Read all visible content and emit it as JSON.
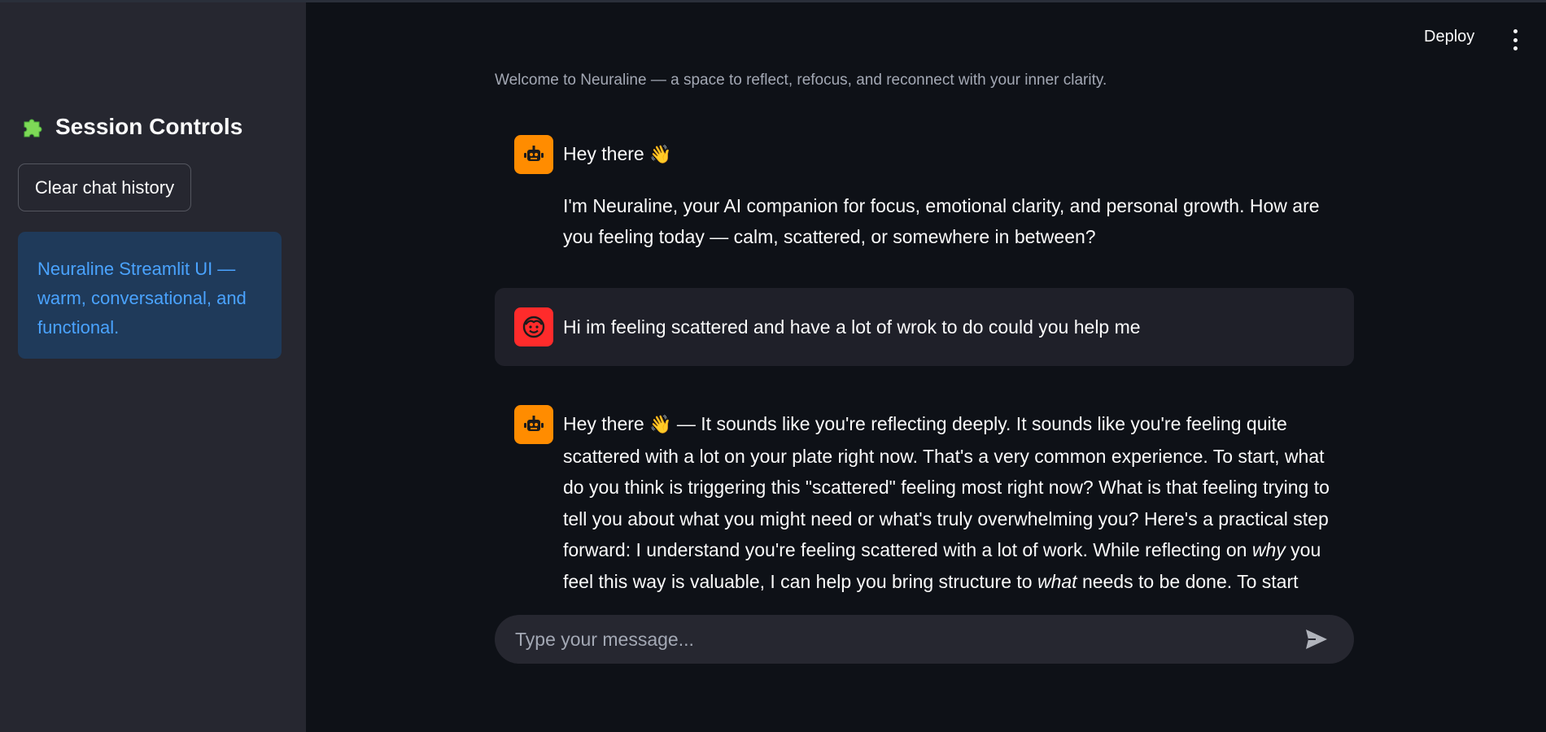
{
  "sidebar": {
    "title_icon": "puzzle-icon",
    "title": "Session Controls",
    "clear_button_label": "Clear chat history",
    "info_text": "Neuraline Streamlit UI — warm, conversational, and functional."
  },
  "header": {
    "deploy_label": "Deploy",
    "menu_icon": "vertical-dots-icon"
  },
  "main": {
    "caption": "Welcome to Neuraline — a space to reflect, refocus, and reconnect with your inner clarity.",
    "messages": [
      {
        "role": "assistant",
        "avatar_icon": "robot-icon",
        "greeting": "Hey there",
        "wave": "👋",
        "body": "I'm Neuraline, your AI companion for focus, emotional clarity, and personal growth. How are you feeling today — calm, scattered, or somewhere in between?"
      },
      {
        "role": "user",
        "avatar_icon": "smiley-face-icon",
        "text": "Hi im feeling scattered and have a lot of wrok to do could you help me"
      },
      {
        "role": "assistant",
        "avatar_icon": "robot-icon",
        "greeting": "Hey there",
        "wave": "👋",
        "text_part1": " — It sounds like you're reflecting deeply. It sounds like you're feeling quite scattered with a lot on your plate right now. That's a very common experience. To start, what do you think is triggering this \"scattered\" feeling most right now? What is that feeling trying to tell you about what you might need or what's truly overwhelming you? Here's a practical step forward: I understand you're feeling scattered with a lot of work. While reflecting on ",
        "emph1": "why",
        "text_part2": " you feel this way is valuable, I can help you bring structure to ",
        "emph2": "what",
        "text_part3": " needs to be done. To start breaking"
      }
    ]
  },
  "chat_input": {
    "placeholder": "Type your message...",
    "send_icon": "send-icon"
  },
  "colors": {
    "sidebar_bg": "#262730",
    "main_bg": "#0e1117",
    "bot_avatar": "#ff8c00",
    "user_avatar": "#ff2b2b",
    "info_bg": "#1f3a5a",
    "info_text": "#4aa3ff"
  }
}
